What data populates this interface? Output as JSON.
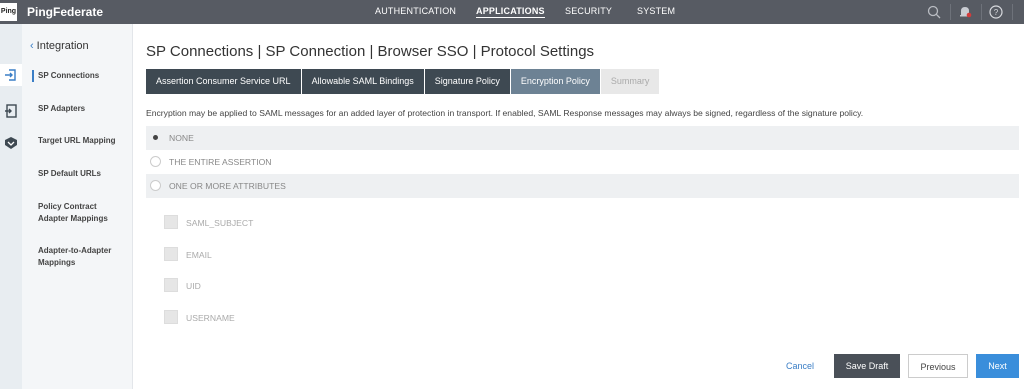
{
  "topbar": {
    "logo_text": "Ping",
    "app_name": "PingFederate",
    "nav": [
      "AUTHENTICATION",
      "APPLICATIONS",
      "SECURITY",
      "SYSTEM"
    ],
    "active_nav": "APPLICATIONS",
    "bg_color": "#575b63"
  },
  "sidebar": {
    "back_label": "Integration",
    "items": [
      {
        "label": "SP Connections",
        "active": true
      },
      {
        "label": "SP Adapters"
      },
      {
        "label": "Target URL Mapping"
      },
      {
        "label": "SP Default URLs"
      },
      {
        "label": "Policy Contract Adapter Mappings"
      },
      {
        "label": "Adapter-to-Adapter Mappings"
      }
    ]
  },
  "rail_icons": [
    "connection-icon",
    "adapter-icon",
    "mapping-icon"
  ],
  "main": {
    "title": "SP Connections | SP Connection | Browser SSO | Protocol Settings",
    "tabs": [
      {
        "label": "Assertion Consumer Service URL",
        "state": "done"
      },
      {
        "label": "Allowable SAML Bindings",
        "state": "done"
      },
      {
        "label": "Signature Policy",
        "state": "done"
      },
      {
        "label": "Encryption Policy",
        "state": "active"
      },
      {
        "label": "Summary",
        "state": "disabled"
      }
    ],
    "description": "Encryption may be applied to SAML messages for an added layer of protection in transport. If enabled, SAML Response messages may always be signed, regardless of the signature policy.",
    "options": [
      {
        "label": "NONE",
        "checked": true
      },
      {
        "label": "THE ENTIRE ASSERTION",
        "checked": false
      },
      {
        "label": "ONE OR MORE ATTRIBUTES",
        "checked": false
      }
    ],
    "attributes": [
      "SAML_SUBJECT",
      "EMAIL",
      "UID",
      "USERNAME"
    ]
  },
  "footer": {
    "cancel": "Cancel",
    "save_draft": "Save Draft",
    "previous": "Previous",
    "next": "Next"
  },
  "colors": {
    "accent": "#3a8edb",
    "tab_dark": "#3e4952",
    "tab_active": "#6d8294"
  }
}
